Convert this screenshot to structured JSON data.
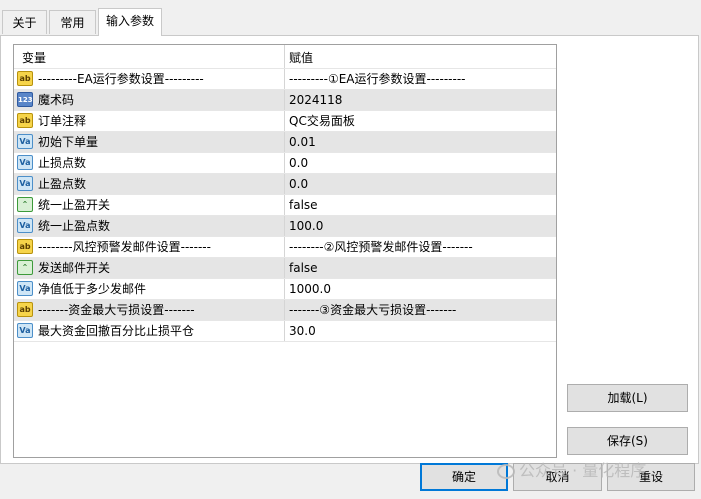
{
  "tabs": [
    {
      "label": "关于"
    },
    {
      "label": "常用"
    },
    {
      "label": "输入参数"
    }
  ],
  "grid": {
    "header": {
      "variable": "变量",
      "value": "赋值"
    },
    "rows": [
      {
        "icon": "ab",
        "variable": "---------EA运行参数设置---------",
        "value": "---------①EA运行参数设置---------"
      },
      {
        "icon": "123",
        "variable": "魔术码",
        "value": "2024118"
      },
      {
        "icon": "ab",
        "variable": "订单注释",
        "value": "QC交易面板"
      },
      {
        "icon": "va",
        "variable": "初始下单量",
        "value": "0.01"
      },
      {
        "icon": "va",
        "variable": "止损点数",
        "value": "0.0"
      },
      {
        "icon": "va",
        "variable": "止盈点数",
        "value": "0.0"
      },
      {
        "icon": "bool",
        "variable": "统一止盈开关",
        "value": "false"
      },
      {
        "icon": "va",
        "variable": "统一止盈点数",
        "value": "100.0"
      },
      {
        "icon": "ab",
        "variable": "--------风控预警发邮件设置-------",
        "value": "--------②风控预警发邮件设置-------"
      },
      {
        "icon": "bool",
        "variable": "发送邮件开关",
        "value": "false"
      },
      {
        "icon": "va",
        "variable": "净值低于多少发邮件",
        "value": "1000.0"
      },
      {
        "icon": "ab",
        "variable": "-------资金最大亏损设置-------",
        "value": "-------③资金最大亏损设置-------"
      },
      {
        "icon": "va",
        "variable": "最大资金回撤百分比止损平仓",
        "value": "30.0"
      }
    ]
  },
  "side_buttons": {
    "load": "加载(L)",
    "save": "保存(S)"
  },
  "bottom_buttons": {
    "ok": "确定",
    "cancel": "取消",
    "reset": "重设"
  },
  "watermark": "公众号 · 量化程序",
  "icon_glyphs": {
    "ab": "ab",
    "123": "123",
    "va": "Va",
    "bool": "⌃"
  }
}
